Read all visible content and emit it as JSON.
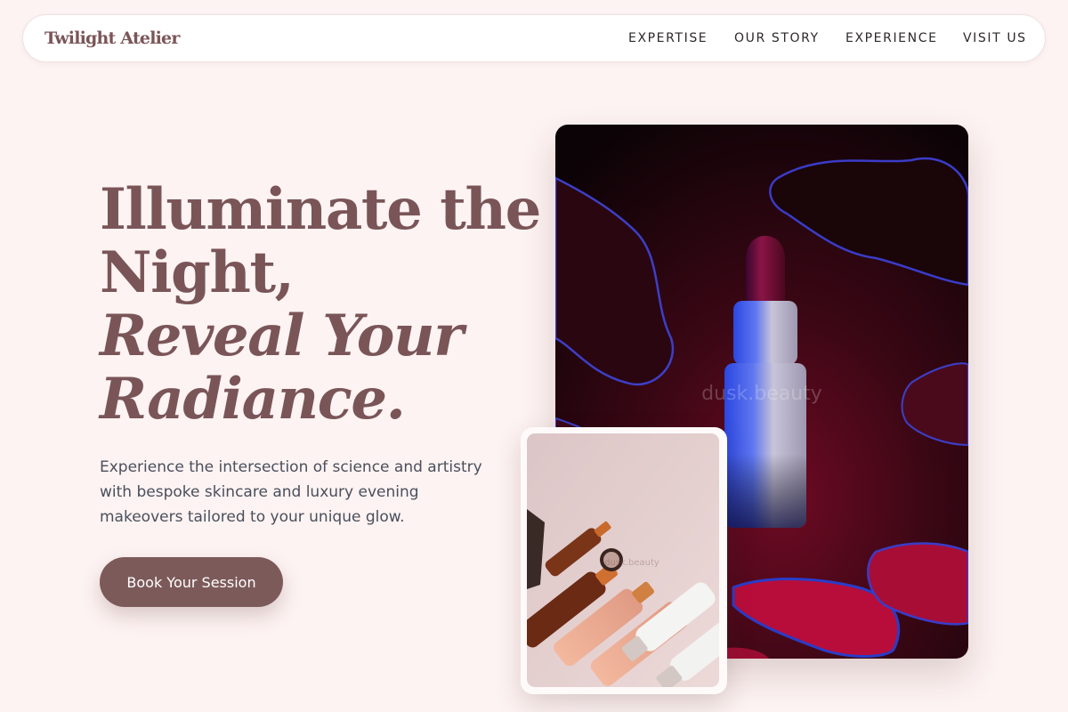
{
  "nav": {
    "brand": "Twilight Atelier",
    "links": [
      "EXPERTISE",
      "OUR STORY",
      "EXPERIENCE",
      "VISIT US"
    ]
  },
  "hero": {
    "heading_lines": [
      "Illuminate the",
      "Night,"
    ],
    "heading_italic_lines": [
      "Reveal Your",
      "Radiance."
    ],
    "description": "Experience the intersection of science and artistry with bespoke skincare and luxury evening makeovers tailored to your unique glow.",
    "cta_label": "Book Your Session"
  },
  "images": {
    "main_watermark": "dusk.beauty",
    "small_watermark": "dusk.beauty"
  },
  "colors": {
    "background": "#fdf3f2",
    "accent": "#7d5a5a",
    "heading": "#7a5558",
    "body_text": "#4a4f5c"
  }
}
